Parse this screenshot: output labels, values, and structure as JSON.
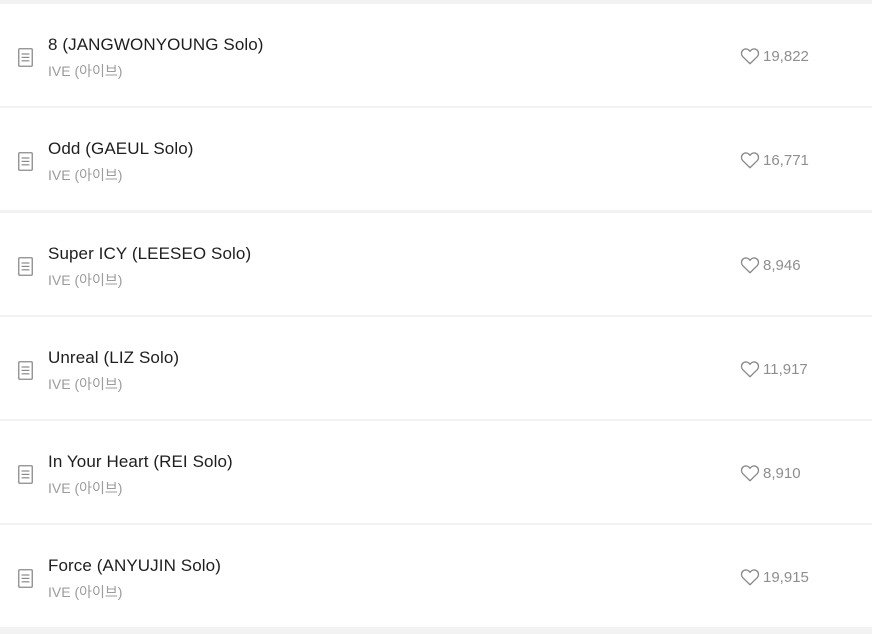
{
  "songs": [
    {
      "title": "8 (JANGWONYOUNG Solo)",
      "artist": "IVE (아이브)",
      "likes": "19,822",
      "lyrics_icon": "lyrics-document-icon",
      "like_icon": "heart-outline-icon"
    },
    {
      "title": "Odd (GAEUL Solo)",
      "artist": "IVE (아이브)",
      "likes": "16,771",
      "lyrics_icon": "lyrics-document-icon",
      "like_icon": "heart-outline-icon"
    },
    {
      "title": "Super ICY (LEESEO Solo)",
      "artist": "IVE (아이브)",
      "likes": "8,946",
      "lyrics_icon": "lyrics-document-icon",
      "like_icon": "heart-outline-icon"
    },
    {
      "title": "Unreal (LIZ Solo)",
      "artist": "IVE (아이브)",
      "likes": "11,917",
      "lyrics_icon": "lyrics-document-icon",
      "like_icon": "heart-outline-icon"
    },
    {
      "title": "In Your Heart (REI Solo)",
      "artist": "IVE (아이브)",
      "likes": "8,910",
      "lyrics_icon": "lyrics-document-icon",
      "like_icon": "heart-outline-icon"
    },
    {
      "title": "Force (ANYUJIN Solo)",
      "artist": "IVE (아이브)",
      "likes": "19,915",
      "lyrics_icon": "lyrics-document-icon",
      "like_icon": "heart-outline-icon"
    }
  ],
  "colors": {
    "title": "#1e1e1e",
    "artist": "#9b9b9b",
    "likes": "#8e8e8e",
    "icon": "#8a8a8a",
    "divider": "#f2f2f2"
  }
}
